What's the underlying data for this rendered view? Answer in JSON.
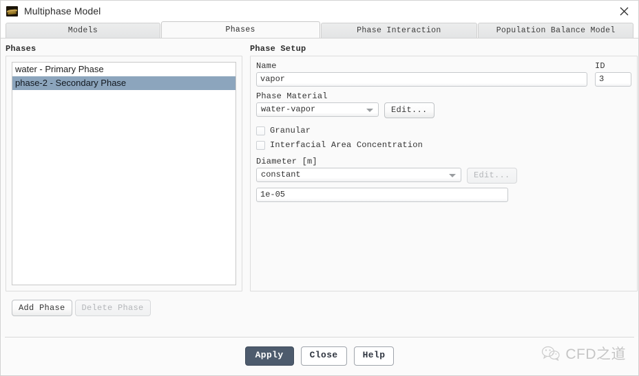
{
  "window": {
    "title": "Multiphase Model",
    "icon": "layers-icon",
    "close_label": "×"
  },
  "tabs": [
    {
      "id": "models",
      "label": "Models",
      "active": false
    },
    {
      "id": "phases",
      "label": "Phases",
      "active": true
    },
    {
      "id": "interaction",
      "label": "Phase Interaction",
      "active": false
    },
    {
      "id": "pbm",
      "label": "Population Balance Model",
      "active": false
    }
  ],
  "phases_panel": {
    "title": "Phases",
    "items": [
      {
        "label": "water - Primary Phase",
        "selected": false
      },
      {
        "label": "phase-2 - Secondary Phase",
        "selected": true
      }
    ],
    "add_button": "Add Phase",
    "delete_button": "Delete Phase",
    "delete_enabled": false
  },
  "phase_setup": {
    "title": "Phase Setup",
    "name_label": "Name",
    "name_value": "vapor",
    "id_label": "ID",
    "id_value": "3",
    "material_label": "Phase Material",
    "material_value": "water-vapor",
    "material_edit_button": "Edit...",
    "material_edit_enabled": true,
    "granular_label": "Granular",
    "granular_checked": false,
    "iac_label": "Interfacial Area Concentration",
    "iac_checked": false,
    "diameter_label": "Diameter [m]",
    "diameter_method": "constant",
    "diameter_edit_button": "Edit...",
    "diameter_edit_enabled": false,
    "diameter_value": "1e-05"
  },
  "footer": {
    "apply_label": "Apply",
    "close_label": "Close",
    "help_label": "Help"
  },
  "watermark": {
    "text": "CFD之道",
    "icon": "wechat-icon"
  },
  "colors": {
    "selection": "#8ca5bd",
    "primary_button": "#4d5b6d",
    "tab_active_bg": "#fafafa",
    "tab_inactive_bg": "#e7e8e9"
  }
}
